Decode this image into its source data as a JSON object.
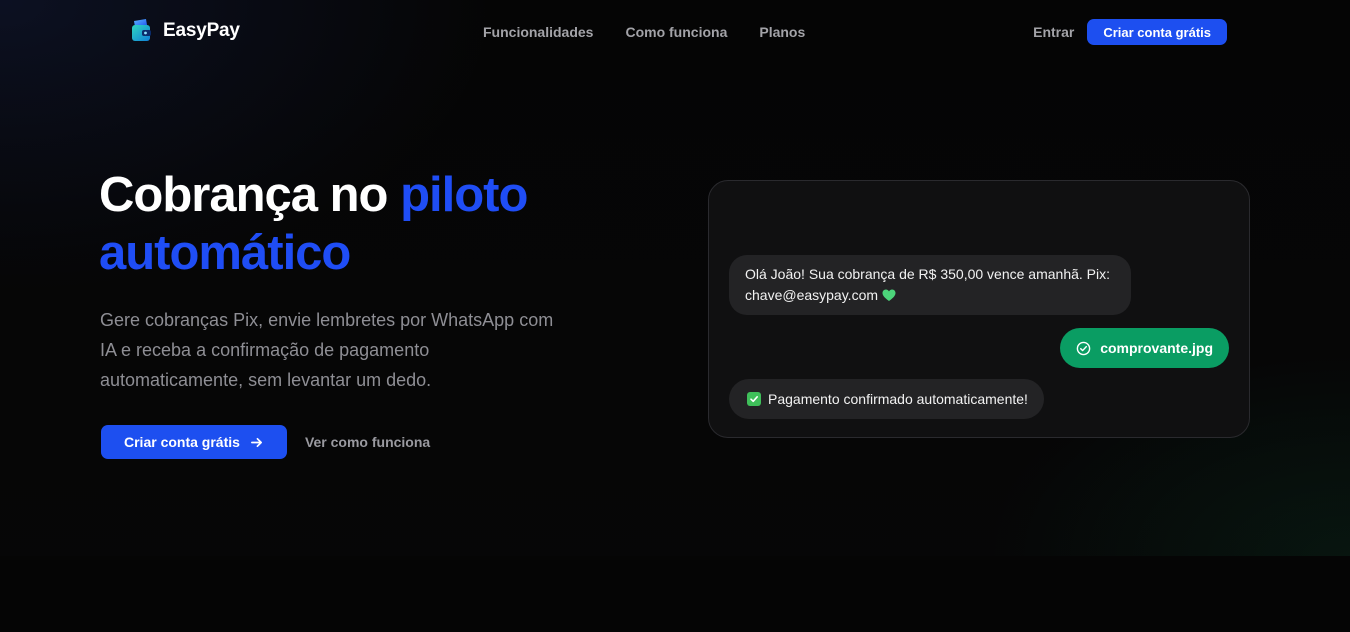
{
  "brand": {
    "name": "EasyPay",
    "logo_icon": "wallet-logo-icon",
    "accent_color": "#1d4ff0",
    "success_color": "#0a9d63"
  },
  "nav": {
    "links": [
      "Funcionalidades",
      "Como funciona",
      "Planos"
    ],
    "login_label": "Entrar",
    "signup_label": "Criar conta grátis"
  },
  "hero": {
    "title_part1": "Cobrança no ",
    "title_accent_1": "piloto",
    "title_accent_2": "automático",
    "subtitle": "Gere cobranças Pix, envie lembretes por WhatsApp com IA e receba a confirmação de pagamento automaticamente, sem levantar um dedo.",
    "cta_primary": "Criar conta grátis",
    "cta_primary_icon": "arrow-right-icon",
    "cta_secondary": "Ver como funciona"
  },
  "chat": {
    "messages": [
      {
        "direction": "incoming",
        "text_line1": "Olá João! Sua cobrança de R$ 350,00 vence amanhã. Pix:",
        "text_line2": "chave@easypay.com",
        "emoji": "green-heart-icon"
      },
      {
        "direction": "outgoing",
        "text": "comprovante.jpg",
        "icon": "check-circle-icon"
      },
      {
        "direction": "incoming",
        "text": "Pagamento confirmado automaticamente!",
        "icon": "checkbox-checked-icon"
      }
    ]
  }
}
